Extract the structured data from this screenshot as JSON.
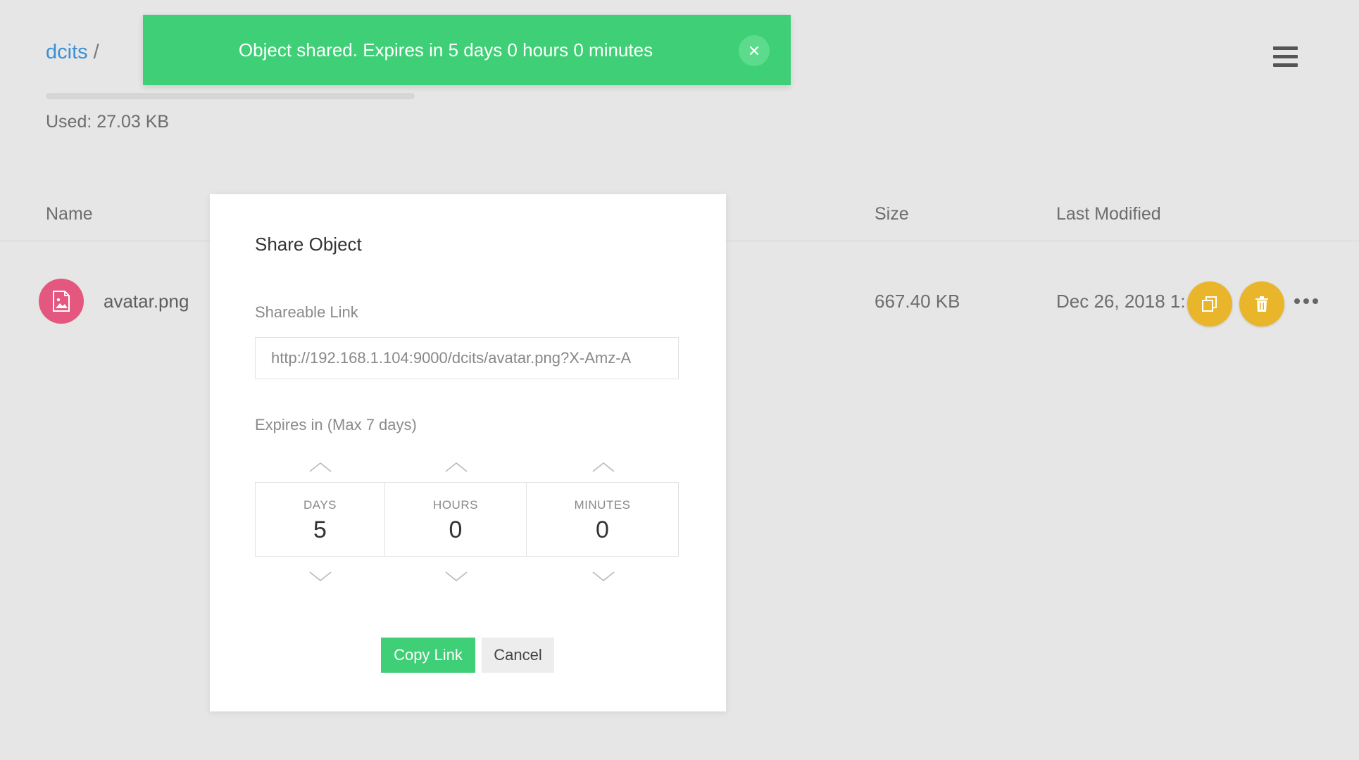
{
  "header": {
    "bucket": "dcits",
    "separator": "/",
    "used": "Used: 27.03 KB"
  },
  "table": {
    "headers": {
      "name": "Name",
      "size": "Size",
      "last_modified": "Last Modified"
    },
    "rows": [
      {
        "name": "avatar.png",
        "size": "667.40 KB",
        "last_modified": "Dec 26, 2018 1:",
        "icon": "image-file-icon",
        "icon_color": "#e4577f"
      }
    ]
  },
  "toast": {
    "message": "Object shared. Expires in 5 days 0 hours 0 minutes",
    "close_glyph": "×",
    "color": "#3fcf76"
  },
  "modal": {
    "title": "Share Object",
    "link_label": "Shareable Link",
    "link_value": "http://192.168.1.104:9000/dcits/avatar.png?X-Amz-A",
    "expires_label": "Expires in (Max 7 days)",
    "expiry": {
      "days_label": "DAYS",
      "days": "5",
      "hours_label": "HOURS",
      "hours": "0",
      "minutes_label": "MINUTES",
      "minutes": "0"
    },
    "copy_button": "Copy Link",
    "cancel_button": "Cancel"
  },
  "colors": {
    "accent_green": "#3fcf76",
    "action_yellow": "#e9b52b",
    "link_blue": "#3a8fd6",
    "background": "#e6e6e6"
  }
}
